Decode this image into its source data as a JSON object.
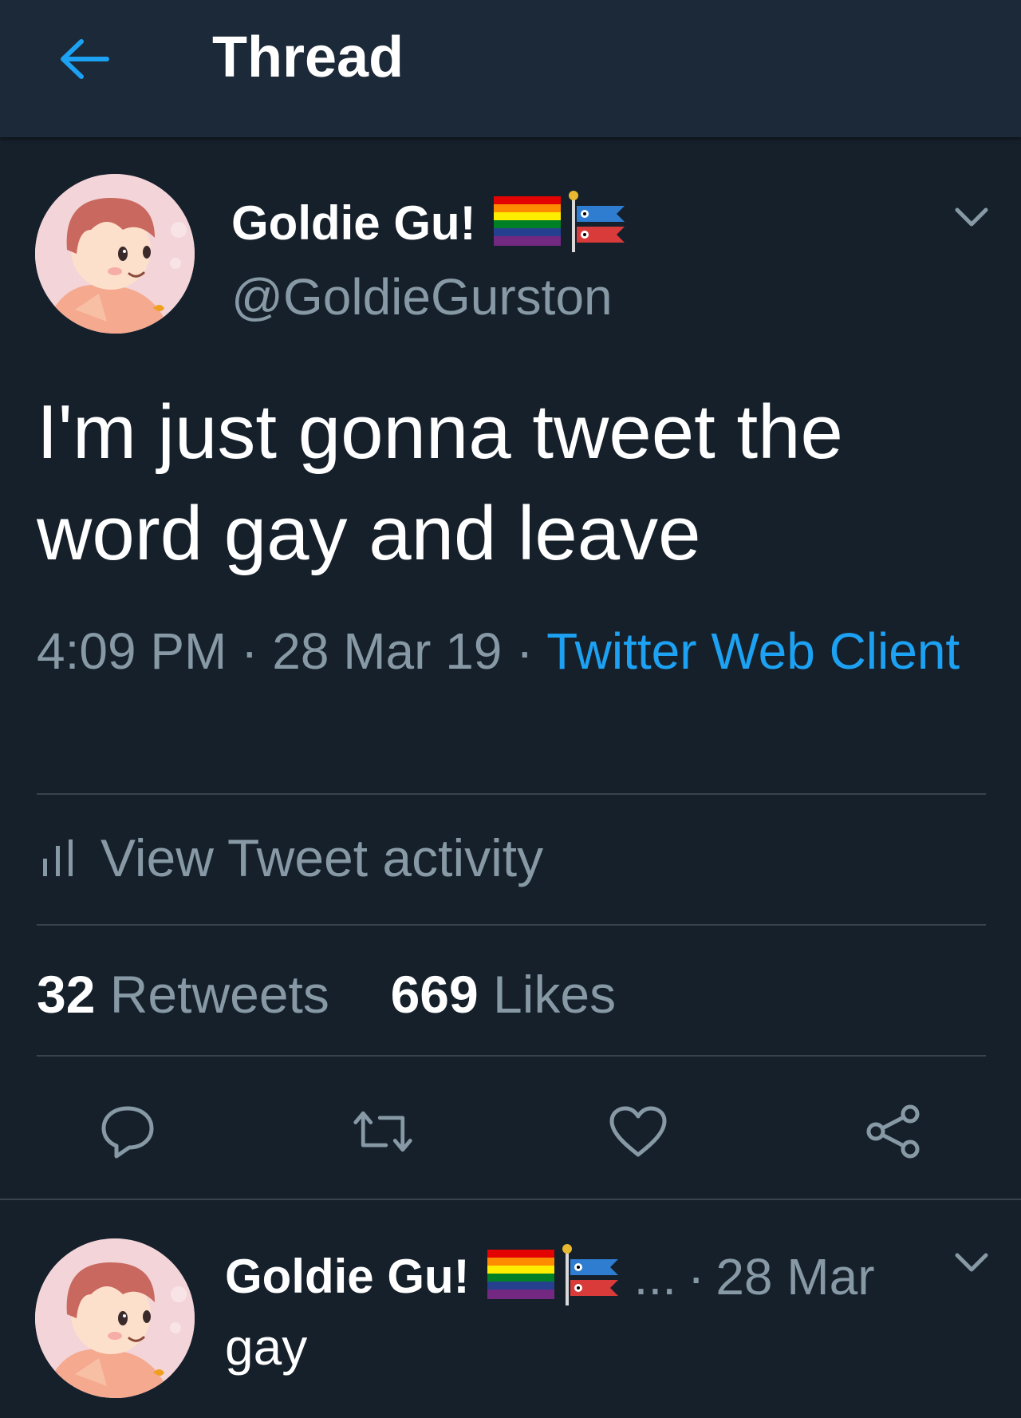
{
  "header": {
    "title": "Thread",
    "back_icon": "arrow-left-icon"
  },
  "colors": {
    "background": "#15202b",
    "header_bg": "#1c2938",
    "accent": "#1da1f2",
    "secondary_text": "#8899a6",
    "divider": "#38444d"
  },
  "main_tweet": {
    "author": {
      "display_name": "Goldie Gu!",
      "handle": "@GoldieGurston",
      "name_emojis": [
        "rainbow-flag-icon",
        "carp-streamer-icon"
      ]
    },
    "text": "I'm just gonna tweet the word gay and leave",
    "time": "4:09 PM",
    "sep1": "·",
    "date": "28 Mar 19",
    "sep2": "·",
    "source": "Twitter Web Client",
    "activity_label": "View Tweet activity",
    "retweets": {
      "count": "32",
      "label": "Retweets"
    },
    "likes": {
      "count": "669",
      "label": "Likes"
    },
    "actions": [
      "reply-icon",
      "retweet-icon",
      "heart-icon",
      "share-icon"
    ]
  },
  "reply_tweet": {
    "display_name": "Goldie Gu!",
    "ellipsis": "...",
    "separator": "·",
    "date": "28 Mar",
    "text": "gay"
  }
}
